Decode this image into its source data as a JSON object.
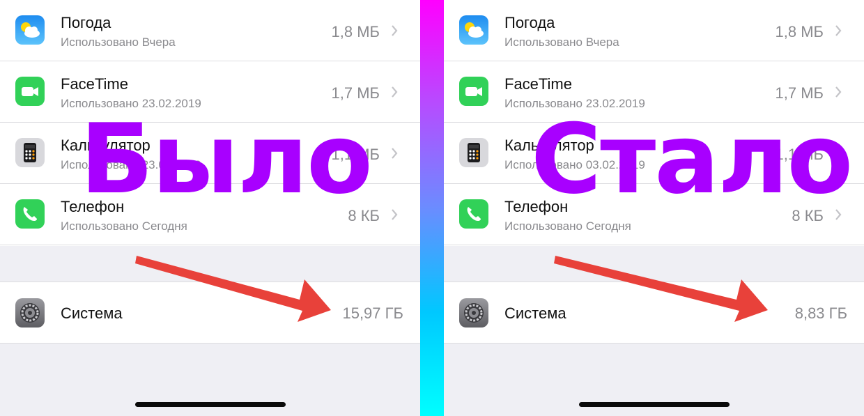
{
  "left": {
    "overlay": "Было",
    "rows": [
      {
        "title": "Погода",
        "subtitle": "Использовано Вчера",
        "size": "1,8 МБ",
        "icon": "weather-icon"
      },
      {
        "title": "FaceTime",
        "subtitle": "Использовано 23.02.2019",
        "size": "1,7 МБ",
        "icon": "facetime-icon"
      },
      {
        "title": "Калькулятор",
        "subtitle": "Использовано 23.02.2019",
        "size": "1,1 МБ",
        "icon": "calculator-icon"
      },
      {
        "title": "Телефон",
        "subtitle": "Использовано Сегодня",
        "size": "8 КБ",
        "icon": "phone-icon"
      }
    ],
    "system": {
      "title": "Система",
      "size": "15,97 ГБ",
      "icon": "settings-gear-icon"
    }
  },
  "right": {
    "overlay": "Стало",
    "rows": [
      {
        "title": "Погода",
        "subtitle": "Использовано Вчера",
        "size": "1,8 МБ",
        "icon": "weather-icon"
      },
      {
        "title": "FaceTime",
        "subtitle": "Использовано 23.02.2019",
        "size": "1,7 МБ",
        "icon": "facetime-icon"
      },
      {
        "title": "Калькулятор",
        "subtitle": "Использовано 03.02.2019",
        "size": "1,1 МБ",
        "icon": "calculator-icon"
      },
      {
        "title": "Телефон",
        "subtitle": "Использовано Сегодня",
        "size": "8 КБ",
        "icon": "phone-icon"
      }
    ],
    "system": {
      "title": "Система",
      "size": "8,83 ГБ",
      "icon": "settings-gear-icon"
    }
  },
  "colors": {
    "overlay_text": "#a800ff",
    "arrow": "#e8413a",
    "divider_top": "#ff00ff",
    "divider_bottom": "#00ffff"
  }
}
